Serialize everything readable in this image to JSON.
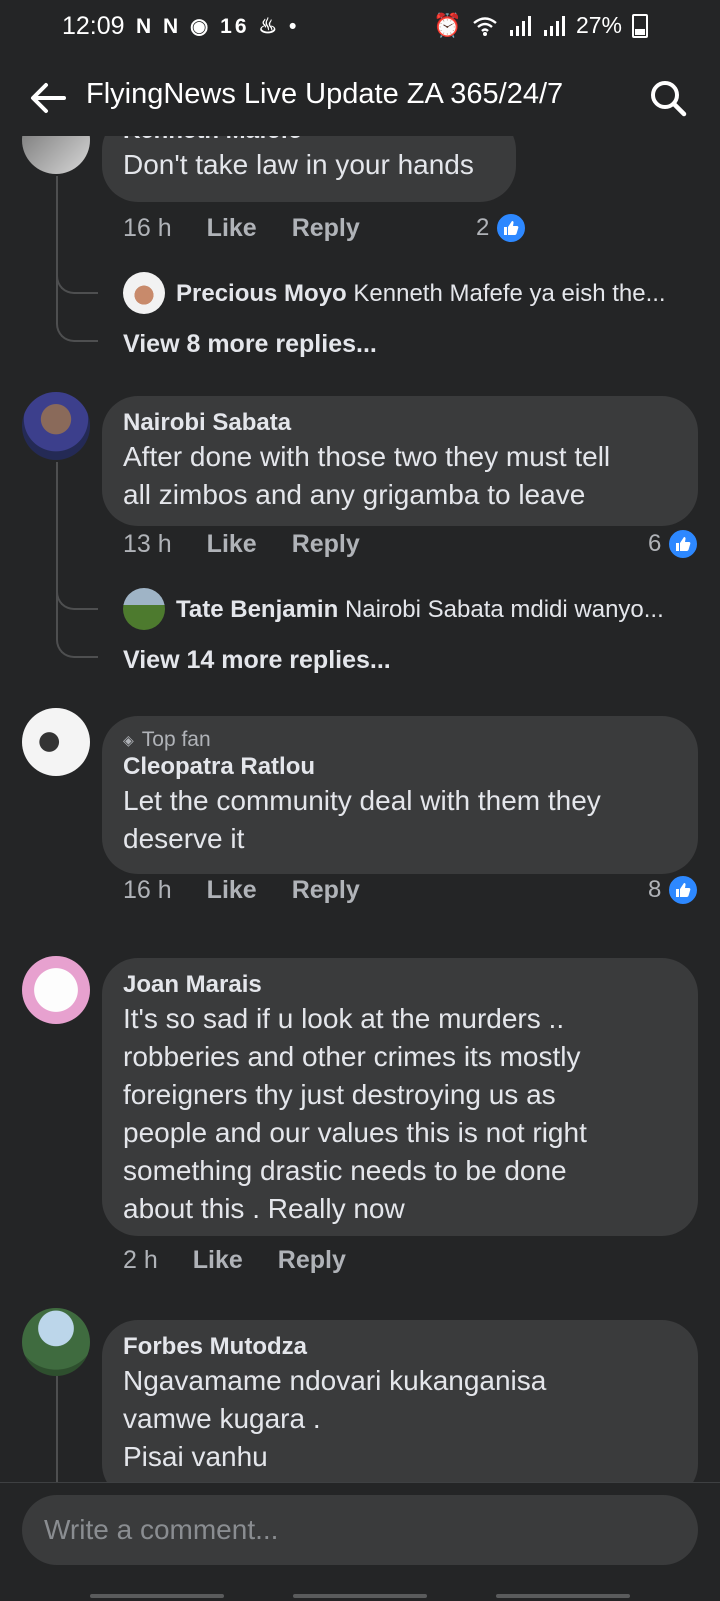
{
  "status_bar": {
    "time": "12:09",
    "left_icons": "N N ◉ 16 ♨ •",
    "battery": "27%"
  },
  "header": {
    "title": "FlyingNews Live Update ZA 365/24/7"
  },
  "comments": [
    {
      "author": "Kenneth Mafefe",
      "text": "Don't take law in your hands",
      "time": "16 h",
      "like_label": "Like",
      "reply_label": "Reply",
      "reaction_count": "2",
      "reply_preview": {
        "author": "Precious Moyo",
        "text": "Kenneth Mafefe ya eish the..."
      },
      "view_more": "View 8 more replies..."
    },
    {
      "author": "Nairobi Sabata",
      "text": "After done with those two they must tell\nall zimbos and  any grigamba to leave",
      "time": "13 h",
      "like_label": "Like",
      "reply_label": "Reply",
      "reaction_count": "6",
      "reply_preview": {
        "author": "Tate Benjamin",
        "text": "Nairobi Sabata mdidi wanyo..."
      },
      "view_more": "View 14 more replies..."
    },
    {
      "badge": "Top fan",
      "author": "Cleopatra Ratlou",
      "text": "Let the community deal with them they\ndeserve it",
      "time": "16 h",
      "like_label": "Like",
      "reply_label": "Reply",
      "reaction_count": "8"
    },
    {
      "author": "Joan Marais",
      "text": "It's so sad if u look at the murders ..\nrobberies and other crimes its mostly\nforeigners thy just destroying us as\npeople and our values this is not right\nsomething drastic needs to be done\nabout this . Really now",
      "time": "2 h",
      "like_label": "Like",
      "reply_label": "Reply"
    },
    {
      "author": "Forbes Mutodza",
      "text": "Ngavamame ndovari kukanganisa\nvamwe kugara .\nPisai vanhu"
    }
  ],
  "composer": {
    "placeholder": "Write a comment..."
  },
  "colors": {
    "background": "#242526",
    "bubble": "#3a3b3c",
    "like_blue": "#2d88ff",
    "secondary_text": "#b0b3b8"
  }
}
